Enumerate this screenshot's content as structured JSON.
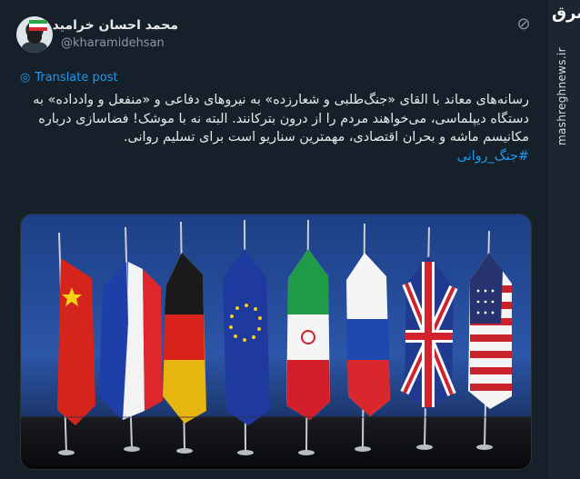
{
  "user": {
    "display_name": "محمد احسان خرامید",
    "handle": "@kharamidehsan"
  },
  "actions": {
    "translate_label": "Translate post"
  },
  "tweet": {
    "text": "رسانه‌های معاند با القای «جنگ‌طلبی و شعارزده» به نیروهای دفاعی و «منفعل و وادداده» به دستگاه دیپلماسی، می‌خواهند مردم را از درون بترکانند. البته نه با موشک! فضاسازی درباره مکانیسم ماشه و بحران اقتصادی، مهمترین سناریو است برای تسلیم روانی.",
    "hashtag": "#جنگ_روانی"
  },
  "media": {
    "flags": [
      "china",
      "france",
      "germany",
      "european-union",
      "iran",
      "russia",
      "united-kingdom",
      "united-states"
    ]
  },
  "watermark": {
    "brand": "مشرق",
    "url": "mashreghnews.ir"
  },
  "icons": {
    "more": "more-options-icon",
    "translate": "translate-globe-icon"
  }
}
